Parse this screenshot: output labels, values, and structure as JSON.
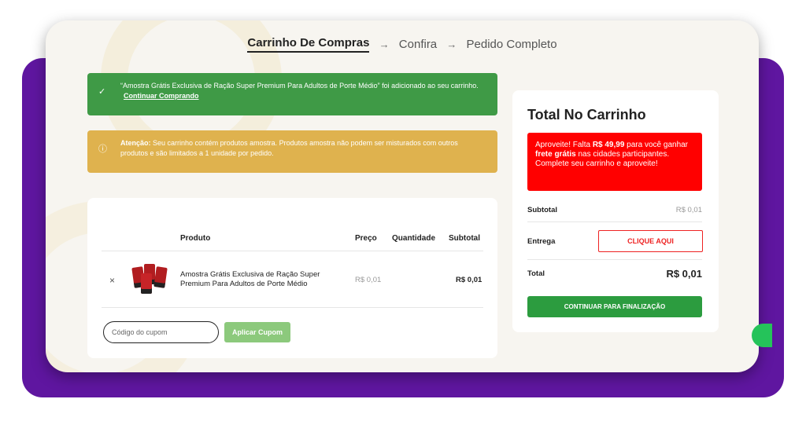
{
  "steps": {
    "cart": "Carrinho De Compras",
    "confirm": "Confira",
    "complete": "Pedido Completo",
    "arrow": "→"
  },
  "notices": {
    "success_text": "“Amostra Grátis Exclusiva de Ração Super Premium Para Adultos de Porte Médio” foi adicionado ao seu carrinho.",
    "success_link": "Continuar Comprando",
    "warning_bold": "Atenção:",
    "warning_text": "Seu carrinho contém produtos amostra. Produtos amostra não podem ser misturados com outros produtos e são limitados a 1 unidade por pedido."
  },
  "cart": {
    "columns": {
      "product": "Produto",
      "price": "Preço",
      "quantity": "Quantidade",
      "subtotal": "Subtotal"
    },
    "items": [
      {
        "remove": "×",
        "name": "Amostra Grátis Exclusiva de Ração Super Premium Para Adultos de Porte Médio",
        "price": "R$ 0,01",
        "subtotal": "R$ 0,01"
      }
    ],
    "coupon_placeholder": "Código do cupom",
    "apply_label": "Aplicar Cupom"
  },
  "totals": {
    "title": "Total No Carrinho",
    "promo_1": "Aproveite! Falta ",
    "promo_amount": "R$ 49,99",
    "promo_2": " para você ganhar ",
    "promo_free": "frete grátis",
    "promo_3": " nas cidades participantes. Complete seu carrinho e aproveite!",
    "subtotal_label": "Subtotal",
    "subtotal_value": "R$ 0,01",
    "shipping_label": "Entrega",
    "shipping_button": "CLIQUE AQUI",
    "total_label": "Total",
    "total_value": "R$ 0,01",
    "checkout_label": "CONTINUAR PARA FINALIZAÇÃO"
  },
  "colors": {
    "purple": "#5f16a0",
    "success": "#3f9a46",
    "warning": "#dfb24e",
    "promo": "#ff0000",
    "checkout": "#2c9c3f"
  }
}
